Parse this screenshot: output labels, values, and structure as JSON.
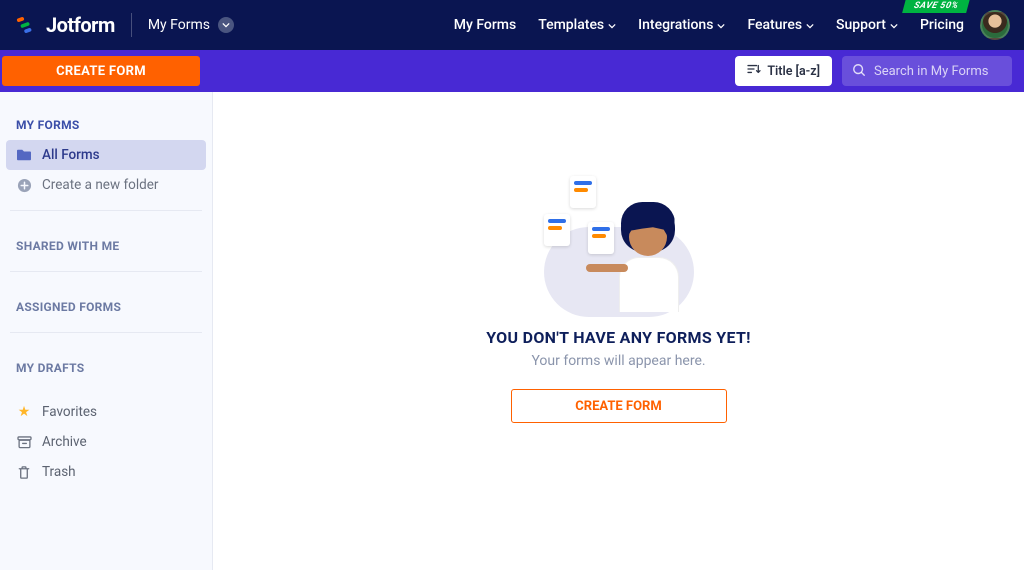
{
  "brand": {
    "name": "Jotform"
  },
  "context": {
    "label": "My Forms"
  },
  "topnav": {
    "items": [
      {
        "label": "My Forms",
        "dropdown": false
      },
      {
        "label": "Templates",
        "dropdown": true
      },
      {
        "label": "Integrations",
        "dropdown": true
      },
      {
        "label": "Features",
        "dropdown": true
      },
      {
        "label": "Support",
        "dropdown": true
      },
      {
        "label": "Pricing",
        "dropdown": false
      }
    ],
    "promo_badge": "SAVE 50%"
  },
  "toolbar": {
    "sort_label": "Title [a-z]",
    "search_placeholder": "Search in My Forms"
  },
  "sidebar": {
    "create_label": "CREATE FORM",
    "sections": {
      "my_forms": "MY FORMS",
      "shared": "SHARED WITH ME",
      "assigned": "ASSIGNED FORMS",
      "drafts": "MY DRAFTS"
    },
    "items": {
      "all_forms": "All Forms",
      "new_folder": "Create a new folder",
      "favorites": "Favorites",
      "archive": "Archive",
      "trash": "Trash"
    }
  },
  "empty_state": {
    "title": "YOU DON'T HAVE ANY FORMS YET!",
    "subtitle": "Your forms will appear here.",
    "cta": "CREATE FORM"
  }
}
